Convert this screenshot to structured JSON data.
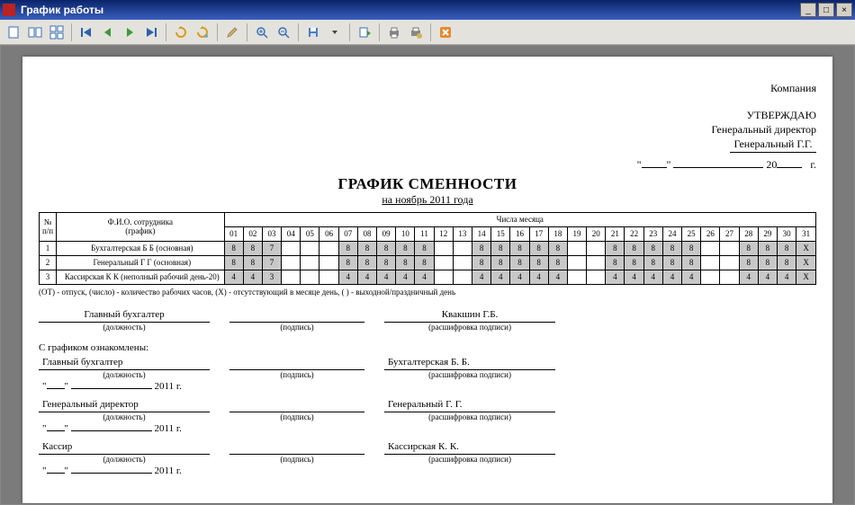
{
  "window": {
    "title": "График работы"
  },
  "doc": {
    "company": "Компания",
    "approve": {
      "word": "УТВЕРЖДАЮ",
      "position": "Генеральный директор",
      "name": "Генеральный Г.Г.",
      "year_prefix": "20",
      "year_suffix": "г."
    },
    "title": "ГРАФИК СМЕННОСТИ",
    "period": "на ноябрь 2011 года",
    "table": {
      "col_num": "№ п/п",
      "col_fio": "Ф.И.О. сотрудника\n(график)",
      "col_month": "Числа месяца",
      "days": [
        "01",
        "02",
        "03",
        "04",
        "05",
        "06",
        "07",
        "08",
        "09",
        "10",
        "11",
        "12",
        "13",
        "14",
        "15",
        "16",
        "17",
        "18",
        "19",
        "20",
        "21",
        "22",
        "23",
        "24",
        "25",
        "26",
        "27",
        "28",
        "29",
        "30",
        "31"
      ],
      "rows": [
        {
          "n": "1",
          "fio": "Бухгалтерская Б Б (основная)",
          "cells": [
            "8",
            "8",
            "7",
            "",
            "",
            "",
            "8",
            "8",
            "8",
            "8",
            "8",
            "",
            "",
            "8",
            "8",
            "8",
            "8",
            "8",
            "",
            "",
            "8",
            "8",
            "8",
            "8",
            "8",
            "",
            "",
            "8",
            "8",
            "8",
            "X"
          ]
        },
        {
          "n": "2",
          "fio": "Генеральный Г Г (основная)",
          "cells": [
            "8",
            "8",
            "7",
            "",
            "",
            "",
            "8",
            "8",
            "8",
            "8",
            "8",
            "",
            "",
            "8",
            "8",
            "8",
            "8",
            "8",
            "",
            "",
            "8",
            "8",
            "8",
            "8",
            "8",
            "",
            "",
            "8",
            "8",
            "8",
            "X"
          ]
        },
        {
          "n": "3",
          "fio": "Кассирская К К (неполный рабочий день-20)",
          "cells": [
            "4",
            "4",
            "3",
            "",
            "",
            "",
            "4",
            "4",
            "4",
            "4",
            "4",
            "",
            "",
            "4",
            "4",
            "4",
            "4",
            "4",
            "",
            "",
            "4",
            "4",
            "4",
            "4",
            "4",
            "",
            "",
            "4",
            "4",
            "4",
            "X"
          ]
        }
      ],
      "shaded": [
        0,
        1,
        2,
        6,
        7,
        8,
        9,
        10,
        13,
        14,
        15,
        16,
        17,
        20,
        21,
        22,
        23,
        24,
        27,
        28,
        29,
        30
      ]
    },
    "legend": "(ОТ) - отпуск, (число) - количество рабочих часов, (X) - отсутствующий в месяце день, ( ) - выходной/праздничный день",
    "sign1": {
      "position": "Главный бухгалтер",
      "cap_pos": "(должность)",
      "cap_sig": "(подпись)",
      "name": "Квакшин Г.Б.",
      "cap_name": "(расшифровка подписи)"
    },
    "acq_title": "С графиком ознакомлены:",
    "acq": [
      {
        "position": "Главный бухгалтер",
        "name": "Бухгалтерская Б. Б."
      },
      {
        "position": "Генеральный директор",
        "name": "Генеральный Г. Г."
      },
      {
        "position": "Кассир",
        "name": "Кассирская К. К."
      }
    ],
    "acq_caps": {
      "pos": "(должность)",
      "sig": "(подпись)",
      "name": "(расшифровка подписи)"
    },
    "date_ack": "2011 г."
  }
}
